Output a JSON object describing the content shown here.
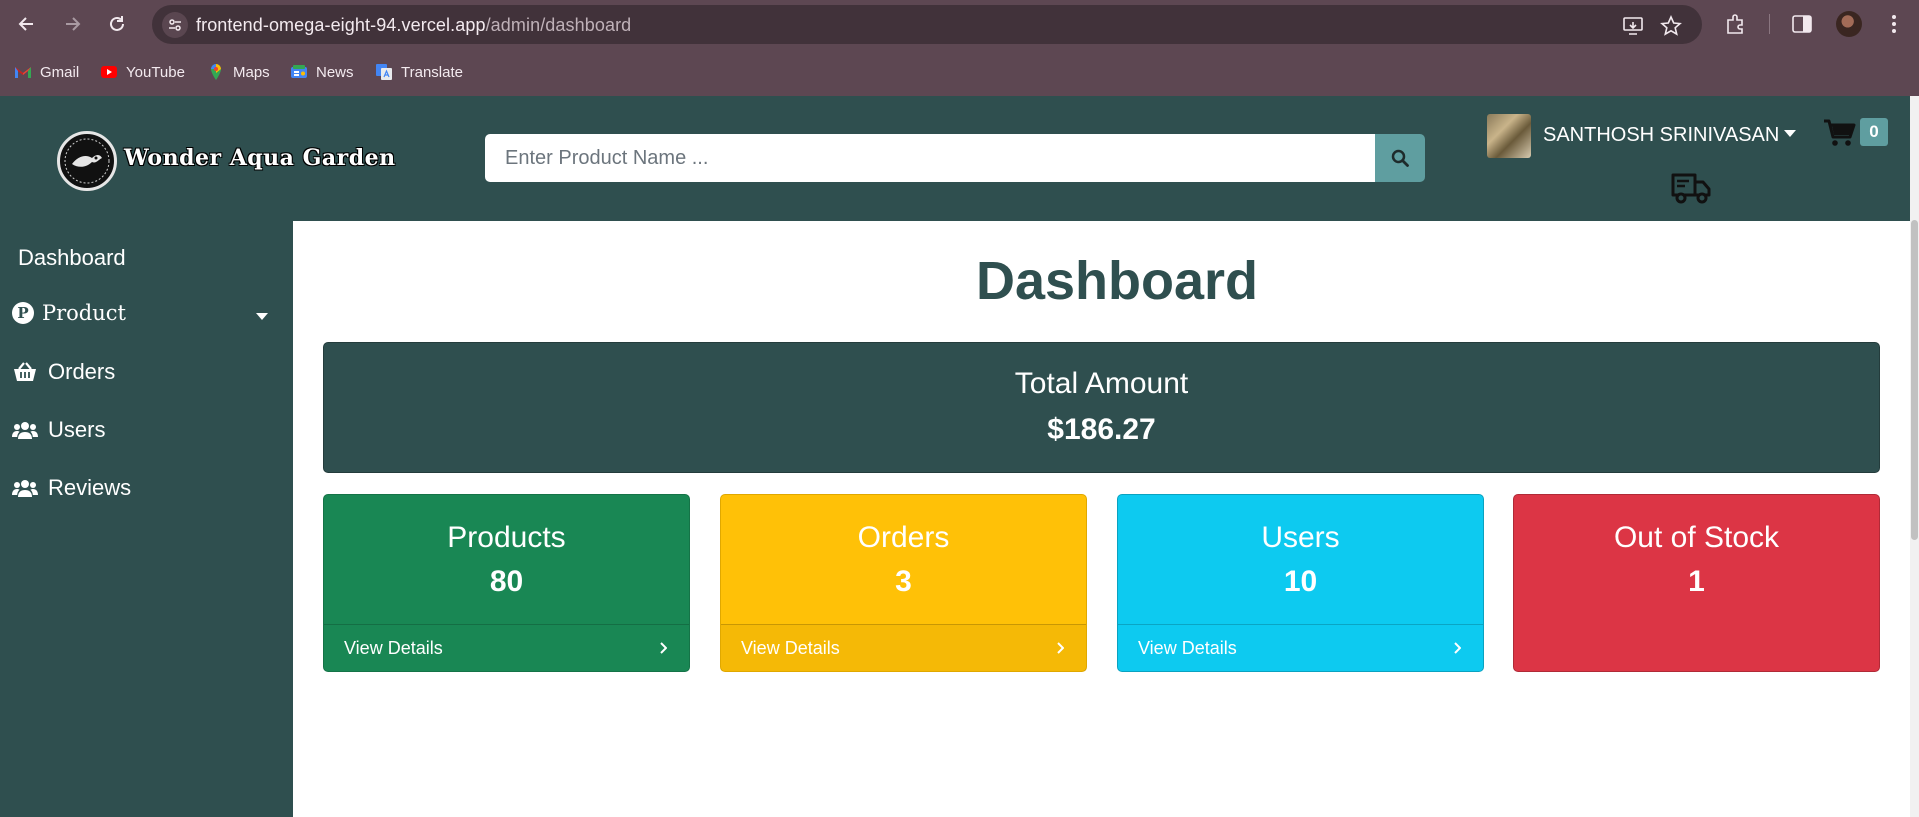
{
  "browser": {
    "url_host": "frontend-omega-eight-94.vercel.app",
    "url_path": "/admin/dashboard",
    "bookmarks": [
      "Gmail",
      "YouTube",
      "Maps",
      "News",
      "Translate"
    ]
  },
  "header": {
    "brand": "Wonder Aqua Garden",
    "search_placeholder": "Enter Product Name ...",
    "user_name": "SANTHOSH SRINIVASAN",
    "cart_count": "0"
  },
  "sidebar": {
    "items": [
      {
        "label": "Dashboard",
        "icon": ""
      },
      {
        "label": "Product",
        "icon": "product-p-icon"
      },
      {
        "label": "Orders",
        "icon": "basket-icon"
      },
      {
        "label": "Users",
        "icon": "users-icon"
      },
      {
        "label": "Reviews",
        "icon": "users-icon"
      }
    ]
  },
  "main": {
    "title": "Dashboard",
    "total": {
      "label": "Total Amount",
      "value": "$186.27"
    },
    "cards": [
      {
        "label": "Products",
        "value": "80",
        "link": "View Details",
        "color": "#198754"
      },
      {
        "label": "Orders",
        "value": "3",
        "link": "View Details",
        "color": "#ffc107"
      },
      {
        "label": "Users",
        "value": "10",
        "link": "View Details",
        "color": "#0dcaf0"
      },
      {
        "label": "Out of Stock",
        "value": "1",
        "color": "#dc3545"
      }
    ]
  },
  "colors": {
    "theme": "#2f4f4f",
    "accent": "#5f9ea0"
  }
}
